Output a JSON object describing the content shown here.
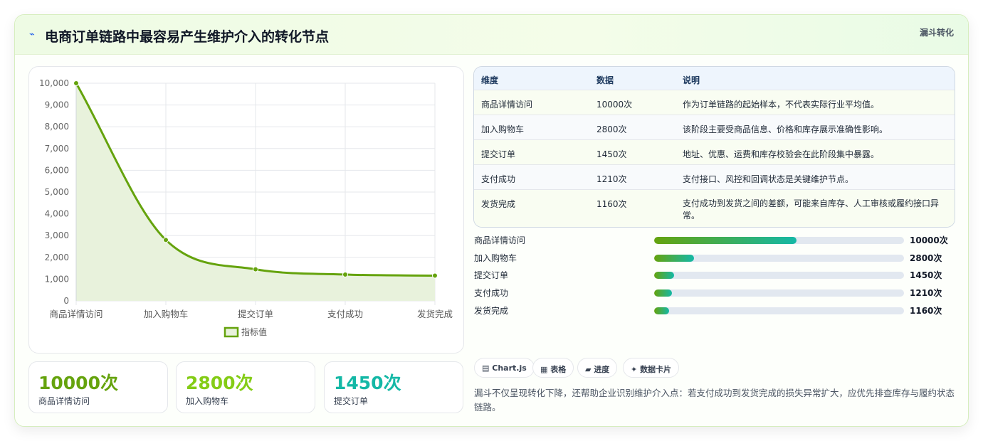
{
  "header": {
    "title": "电商订单链路中最容易产生维护介入的转化节点",
    "tag": "漏斗转化",
    "title_icon": "trend-line-icon"
  },
  "chart_data": {
    "type": "line",
    "categories": [
      "商品详情访问",
      "加入购物车",
      "提交订单",
      "支付成功",
      "发货完成"
    ],
    "series": [
      {
        "name": "指标值",
        "values": [
          10000,
          2800,
          1450,
          1210,
          1160
        ]
      }
    ],
    "ylim": [
      0,
      10000
    ],
    "yticks": [
      "0",
      "1,000",
      "2,000",
      "3,000",
      "4,000",
      "5,000",
      "6,000",
      "7,000",
      "8,000",
      "9,000",
      "10,000"
    ],
    "grid": true,
    "legend": "bottom",
    "fill": true,
    "color": "#65a30d",
    "fill_color": "#e8f2dc"
  },
  "kpis": [
    {
      "value": "10000次",
      "label": "商品详情访问",
      "color": "#65a30d"
    },
    {
      "value": "2800次",
      "label": "加入购物车",
      "color": "#84cc16"
    },
    {
      "value": "1450次",
      "label": "提交订单",
      "color": "#14b8a6"
    }
  ],
  "table": {
    "headers": [
      "维度",
      "数据",
      "说明"
    ],
    "rows": [
      {
        "dim": "商品详情访问",
        "data": "10000次",
        "desc": "作为订单链路的起始样本，不代表实际行业平均值。"
      },
      {
        "dim": "加入购物车",
        "data": "2800次",
        "desc": "该阶段主要受商品信息、价格和库存展示准确性影响。"
      },
      {
        "dim": "提交订单",
        "data": "1450次",
        "desc": "地址、优惠、运费和库存校验会在此阶段集中暴露。"
      },
      {
        "dim": "支付成功",
        "data": "1210次",
        "desc": "支付接口、风控和回调状态是关键维护节点。"
      },
      {
        "dim": "发货完成",
        "data": "1160次",
        "desc": "支付成功到发货之间的差额，可能来自库存、人工审核或履约接口异常。"
      }
    ]
  },
  "progress": [
    {
      "label": "商品详情访问",
      "value": "10000次",
      "fraction": 0.57
    },
    {
      "label": "加入购物车",
      "value": "2800次",
      "fraction": 0.16
    },
    {
      "label": "提交订单",
      "value": "1450次",
      "fraction": 0.08
    },
    {
      "label": "支付成功",
      "value": "1210次",
      "fraction": 0.07
    },
    {
      "label": "发货完成",
      "value": "1160次",
      "fraction": 0.06
    }
  ],
  "pills": [
    {
      "icon": "chart-icon",
      "glyph": "▤",
      "label": "Chart.js"
    },
    {
      "icon": "table-icon",
      "glyph": "▦",
      "label": "表格"
    },
    {
      "icon": "progress-icon",
      "glyph": "▰",
      "label": "进度"
    },
    {
      "icon": "card-icon",
      "glyph": "✦",
      "label": "数据卡片"
    }
  ],
  "note": "漏斗不仅呈现转化下降，还帮助企业识别维护介入点：若支付成功到发货完成的损失异常扩大，应优先排查库存与履约状态链路。"
}
